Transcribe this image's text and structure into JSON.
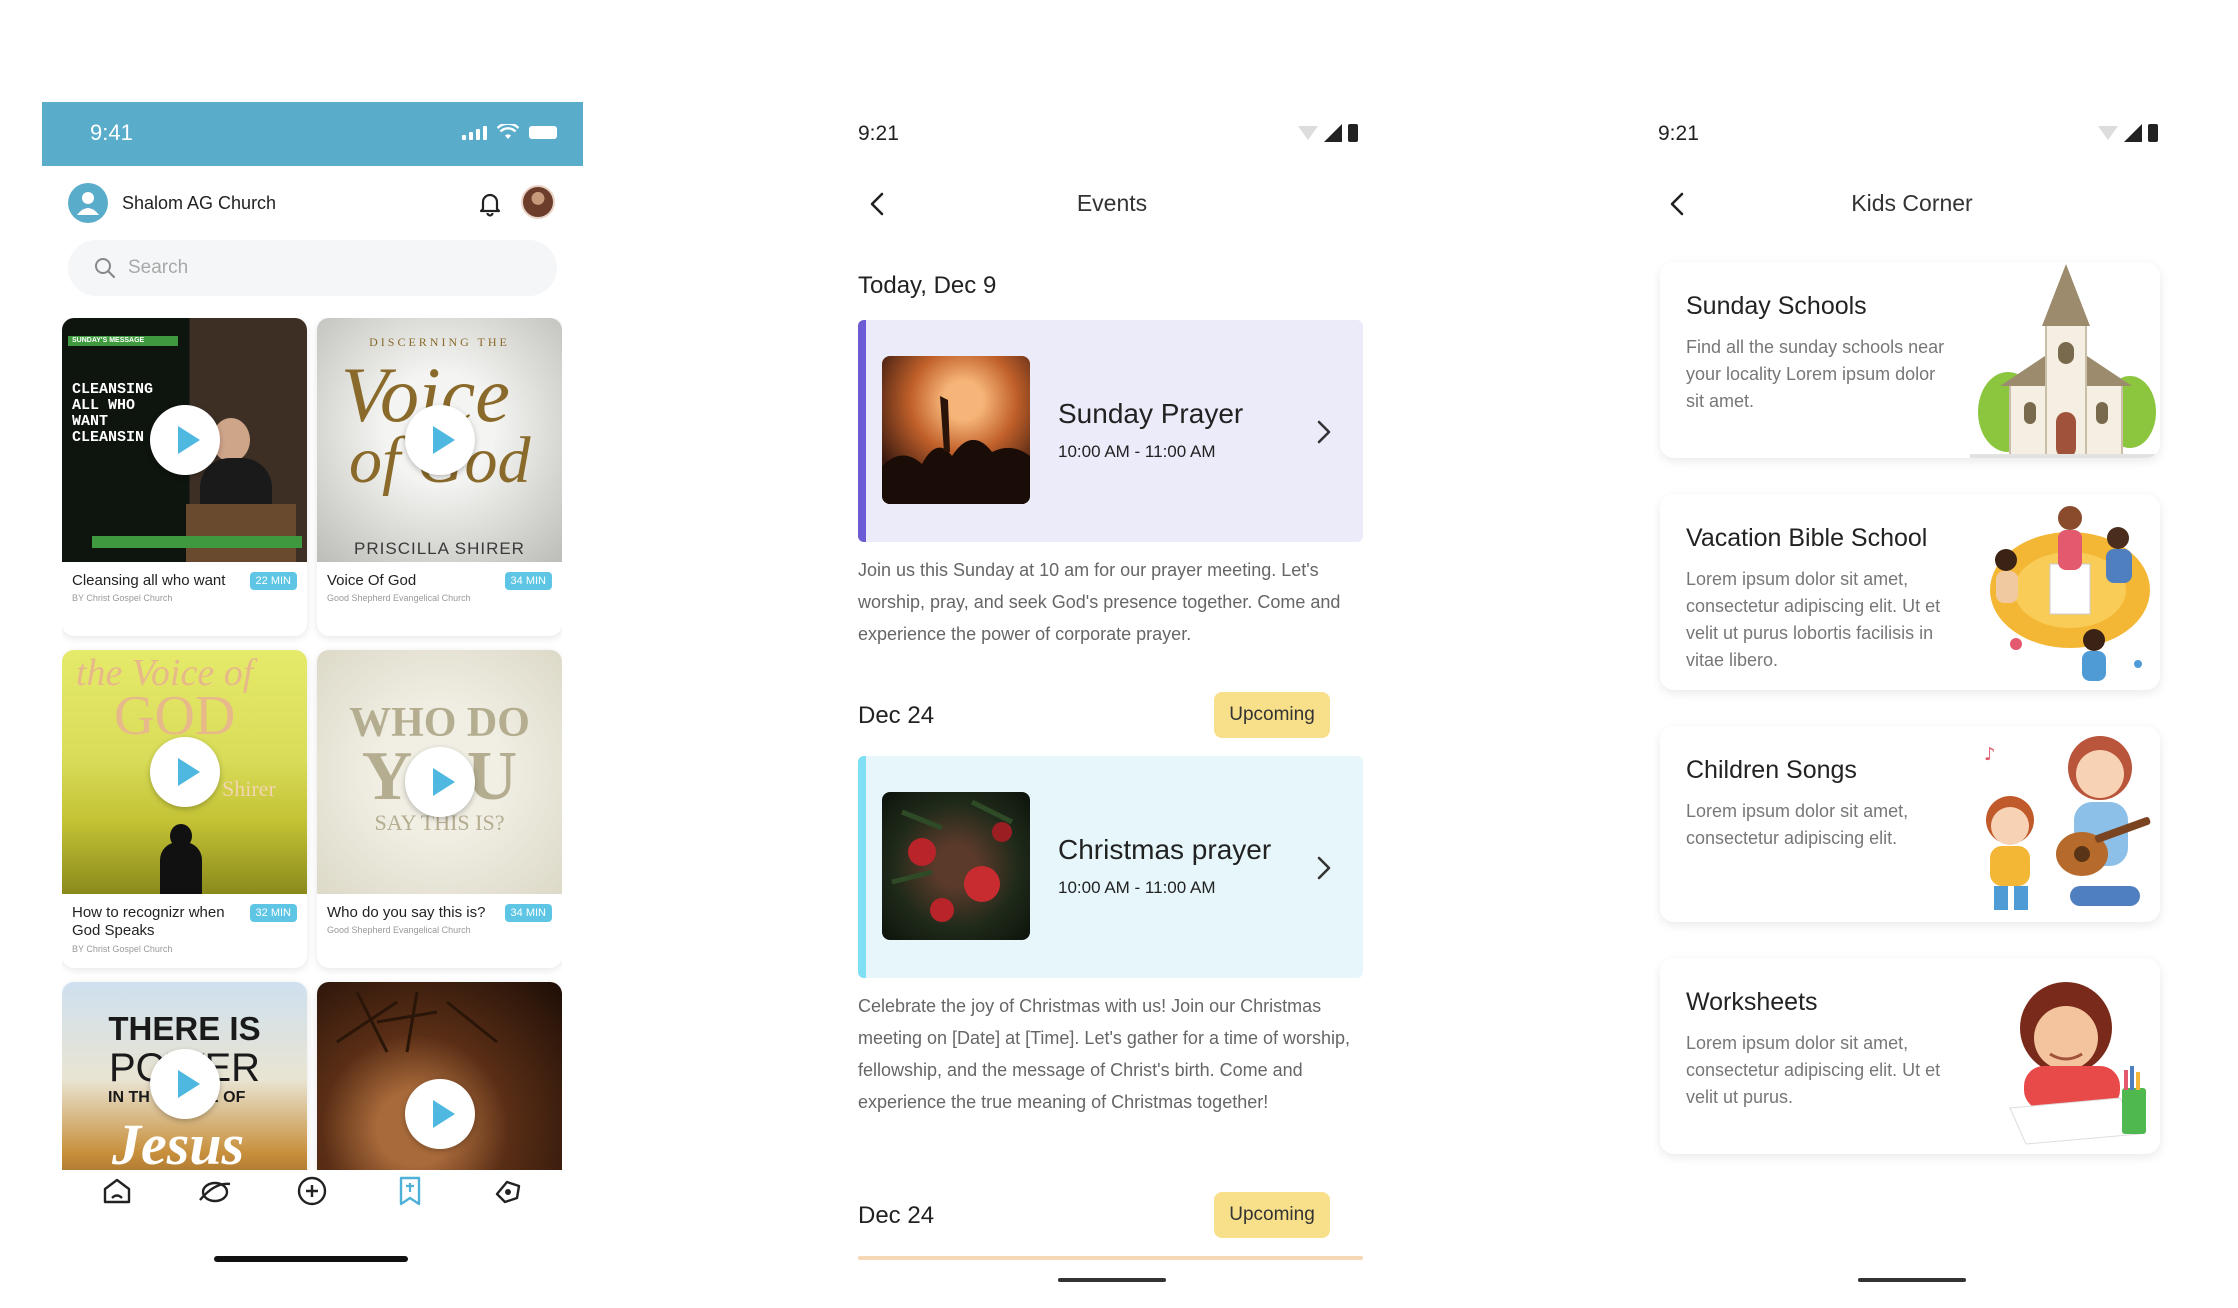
{
  "screen1": {
    "status_time": "9:41",
    "church_name": "Shalom AG Church",
    "search_placeholder": "Search",
    "media": [
      {
        "title": "Cleansing all who want",
        "church": "BY Christ Gospel Church",
        "duration": "22 MIN",
        "thumb_lines": [
          "SUNDAY'S MESSAGE",
          "CLEANSING",
          "ALL WHO",
          "WANT",
          "CLEANSIN"
        ]
      },
      {
        "title": "Voice Of God",
        "church": "Good Shepherd Evangelical Church",
        "duration": "34 MIN",
        "thumb_lines": [
          "DISCERNING THE",
          "Voice",
          "of God",
          "PRISCILLA SHIRER"
        ]
      },
      {
        "title": "How to recognizr when God Speaks",
        "church": "BY Christ Gospel Church",
        "duration": "32 MIN",
        "thumb_lines": [
          "the Voice of",
          "GOD",
          "Shirer"
        ]
      },
      {
        "title": "Who do you say this is?",
        "church": "Good Shepherd Evangelical Church",
        "duration": "34 MIN",
        "thumb_lines": [
          "WHO DO",
          "YOU",
          "SAY THIS IS?"
        ]
      },
      {
        "title": "",
        "church": "",
        "duration": "",
        "thumb_lines": [
          "THERE IS",
          "POWER",
          "IN TH",
          "E OF",
          "Jesus"
        ]
      },
      {
        "title": "",
        "church": "",
        "duration": "",
        "thumb_lines": []
      }
    ],
    "tabs": [
      "home-icon",
      "explore-icon",
      "add-icon",
      "bookmark-icon",
      "community-icon"
    ],
    "accent": "#5aaccb"
  },
  "screen2": {
    "status_time": "9:21",
    "title": "Events",
    "sections": [
      {
        "date": "Today, Dec 9",
        "badge": "",
        "event": {
          "name": "Sunday Prayer",
          "time": "10:00 AM - 11:00 AM"
        },
        "description": "Join us this Sunday at 10 am for our prayer meeting. Let's worship, pray, and seek God's presence together. Come and experience the power of corporate prayer."
      },
      {
        "date": "Dec 24",
        "badge": "Upcoming",
        "event": {
          "name": "Christmas prayer",
          "time": "10:00 AM - 11:00 AM"
        },
        "description": "Celebrate the joy of Christmas with us! Join our Christmas meeting on [Date] at [Time]. Let's gather for a time of worship, fellowship, and the message of Christ's birth. Come and experience the true meaning of Christmas together!"
      },
      {
        "date": "Dec 24",
        "badge": "Upcoming"
      }
    ],
    "colors": {
      "card1_bg": "#ecebfa",
      "card1_bar": "#6b5cd6",
      "card2_bg": "#e6f6fa",
      "card2_bar": "#7fe0f5",
      "badge": "#f8e08a"
    }
  },
  "screen3": {
    "status_time": "9:21",
    "title": "Kids Corner",
    "cards": [
      {
        "title": "Sunday Schools",
        "description": "Find all the sunday schools near your locality Lorem ipsum dolor sit amet.",
        "icon": "church-illustration"
      },
      {
        "title": "Vacation Bible School",
        "description": "Lorem ipsum dolor sit amet, consectetur adipiscing elit. Ut et velit ut purus lobortis facilisis in vitae libero.",
        "icon": "kids-reading-illustration"
      },
      {
        "title": "Children Songs",
        "description": "Lorem ipsum dolor sit amet, consectetur adipiscing elit.",
        "icon": "kids-singing-illustration"
      },
      {
        "title": "Worksheets",
        "description": "Lorem ipsum dolor sit amet, consectetur adipiscing elit. Ut et velit ut purus.",
        "icon": "girl-drawing-illustration"
      }
    ]
  }
}
